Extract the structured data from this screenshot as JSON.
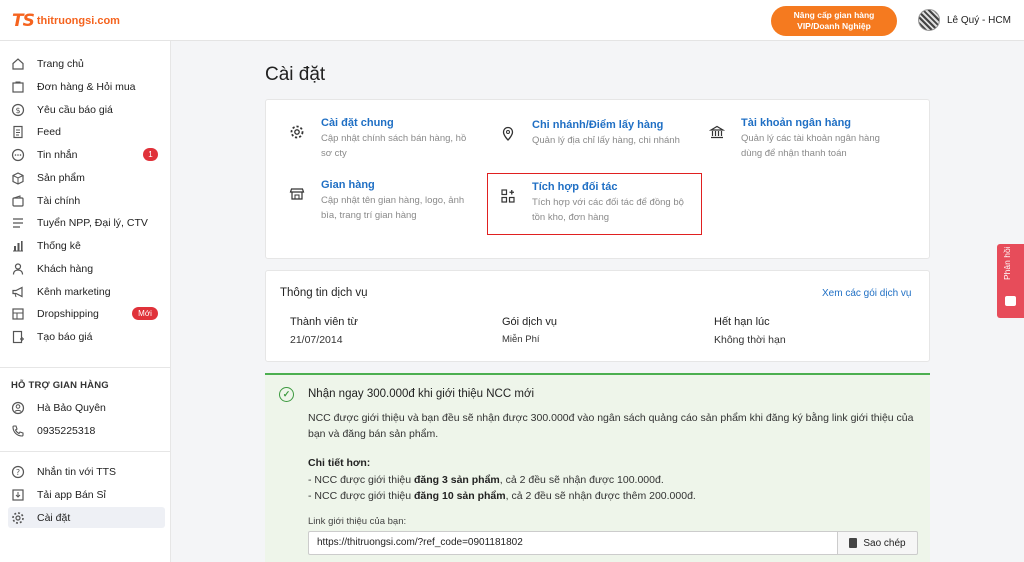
{
  "header": {
    "logo_mark": "TS",
    "logo_text": "thitruongsi.com",
    "upgrade_line1": "Nâng cấp gian hàng",
    "upgrade_line2": "VIP/Doanh Nghiệp",
    "user_name": "Lê Quý - HCM"
  },
  "sidebar": {
    "items": [
      {
        "label": "Trang chủ",
        "icon": "home-icon"
      },
      {
        "label": "Đơn hàng & Hỏi mua",
        "icon": "cart-icon"
      },
      {
        "label": "Yêu cầu báo giá",
        "icon": "dollar-icon"
      },
      {
        "label": "Feed",
        "icon": "document-icon"
      },
      {
        "label": "Tin nhắn",
        "icon": "chat-icon",
        "badge": "1"
      },
      {
        "label": "Sản phẩm",
        "icon": "box-icon"
      },
      {
        "label": "Tài chính",
        "icon": "wallet-icon"
      },
      {
        "label": "Tuyển NPP, Đại lý, CTV",
        "icon": "list-icon"
      },
      {
        "label": "Thống kê",
        "icon": "chart-icon"
      },
      {
        "label": "Khách hàng",
        "icon": "user-icon"
      },
      {
        "label": "Kênh marketing",
        "icon": "megaphone-icon"
      },
      {
        "label": "Dropshipping",
        "icon": "dropship-icon",
        "badge": "Mới"
      },
      {
        "label": "Tạo báo giá",
        "icon": "quote-icon"
      }
    ],
    "support_heading": "HỖ TRỢ GIAN HÀNG",
    "support_name": "Hà Bảo Quyên",
    "support_phone": "0935225318",
    "bottom": [
      {
        "label": "Nhắn tin với TTS",
        "icon": "help-icon"
      },
      {
        "label": "Tải app Bán Sỉ",
        "icon": "download-icon"
      },
      {
        "label": "Cài đặt",
        "icon": "gear-icon"
      }
    ]
  },
  "page_title": "Cài đặt",
  "settings": [
    {
      "title": "Cài đặt chung",
      "desc1": "Cập nhật chính sách bán hàng, hồ",
      "desc2": "sơ cty"
    },
    {
      "title": "Chi nhánh/Điểm lấy hàng",
      "desc1": "Quản lý địa chỉ lấy hàng, chi nhánh",
      "desc2": ""
    },
    {
      "title": "Tài khoản ngân hàng",
      "desc1": "Quản lý các tài khoản ngân hàng",
      "desc2": "dùng để nhận thanh toán"
    },
    {
      "title": "Gian hàng",
      "desc1": "Cập nhật tên gian hàng, logo, ảnh",
      "desc2": "bìa, trang trí gian hàng"
    },
    {
      "title": "Tích hợp đối tác",
      "desc1": "Tích hợp với các đối tác để đồng bộ",
      "desc2": "tồn kho, đơn hàng"
    }
  ],
  "service": {
    "title": "Thông tin dịch vụ",
    "link": "Xem các gói dịch vụ",
    "member_since_label": "Thành viên từ",
    "member_since": "21/07/2014",
    "plan_label": "Gói dịch vụ",
    "plan": "Miễn Phí",
    "expiry_label": "Hết hạn lúc",
    "expiry": "Không thời hạn"
  },
  "promo": {
    "title": "Nhận ngay 300.000đ khi giới thiệu NCC mới",
    "body": "NCC được giới thiệu và bạn đều sẽ nhận được 300.000đ vào ngân sách quảng cáo sản phẩm khi đăng ký bằng link giới thiệu của bạn và đăng bán sản phẩm.",
    "detail_heading": "Chi tiết hơn:",
    "line1_pre": "- NCC được giới thiệu ",
    "line1_bold": "đăng 3 sản phẩm",
    "line1_post": ", cả 2 đều sẽ nhận được 100.000đ.",
    "line2_pre": "- NCC được giới thiệu ",
    "line2_bold": "đăng 10 sản phẩm",
    "line2_post": ", cả 2 đều sẽ nhận được thêm 200.000đ.",
    "ref_label": "Link giới thiệu của bạn:",
    "ref_url": "https://thitruongsi.com/?ref_code=0901181802",
    "copy_label": "Sao chép"
  },
  "feedback_label": "Phản hồi"
}
